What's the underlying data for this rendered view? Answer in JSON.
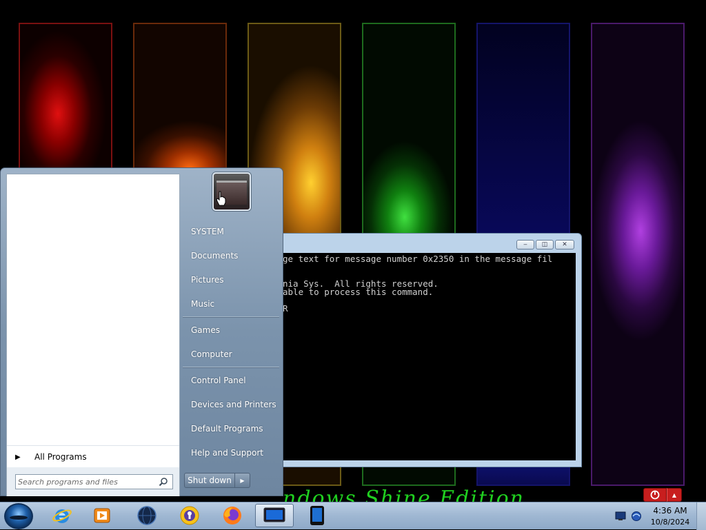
{
  "desktop": {
    "wallpaper_text": "ndows Shine Edition"
  },
  "console": {
    "lines": [
      "ge text for message number 0x2350 in the message fil",
      "",
      "",
      "nia Sys.  All rights reserved.",
      "able to process this command.",
      "",
      "R"
    ],
    "controls": {
      "minimize": "‒",
      "maximize": "◫",
      "close": "✕"
    }
  },
  "start_menu": {
    "user_items": [
      {
        "label": "SYSTEM"
      },
      {
        "label": "Documents"
      },
      {
        "label": "Pictures"
      },
      {
        "label": "Music"
      },
      {
        "label": "Games"
      },
      {
        "label": "Computer"
      },
      {
        "label": "Control Panel"
      },
      {
        "label": "Devices and Printers"
      },
      {
        "label": "Default Programs"
      },
      {
        "label": "Help and Support"
      }
    ],
    "all_programs": {
      "label": "All Programs",
      "icon": "triangle-right-icon"
    },
    "search": {
      "placeholder": "Search programs and files",
      "value": "",
      "icon": "search-icon"
    },
    "shutdown": {
      "label": "Shut down",
      "arrow": "▶"
    }
  },
  "taskbar": {
    "pinned": [
      {
        "name": "internet-explorer",
        "icon": "ie-icon"
      },
      {
        "name": "media-player",
        "icon": "media-player-icon"
      },
      {
        "name": "network",
        "icon": "globe-icon"
      },
      {
        "name": "keyring",
        "icon": "keyhole-icon"
      },
      {
        "name": "firefox",
        "icon": "firefox-icon"
      },
      {
        "name": "console-window",
        "icon": "monitor-icon",
        "active": true
      },
      {
        "name": "tablet",
        "icon": "tablet-icon"
      }
    ],
    "clock": {
      "time": "4:36 AM",
      "date": "10/8/2024"
    },
    "tray_icons": [
      "display-icon",
      "network-status-icon"
    ],
    "notify_arrow": "▲"
  },
  "colors": {
    "taskbar_top": "#b9cde3",
    "start_menu_right": "#7b93ac",
    "console_background": "#000000",
    "console_text": "#d0d0d0",
    "wallpaper_text": "#20d020",
    "notify_red": "#c81e1e"
  }
}
